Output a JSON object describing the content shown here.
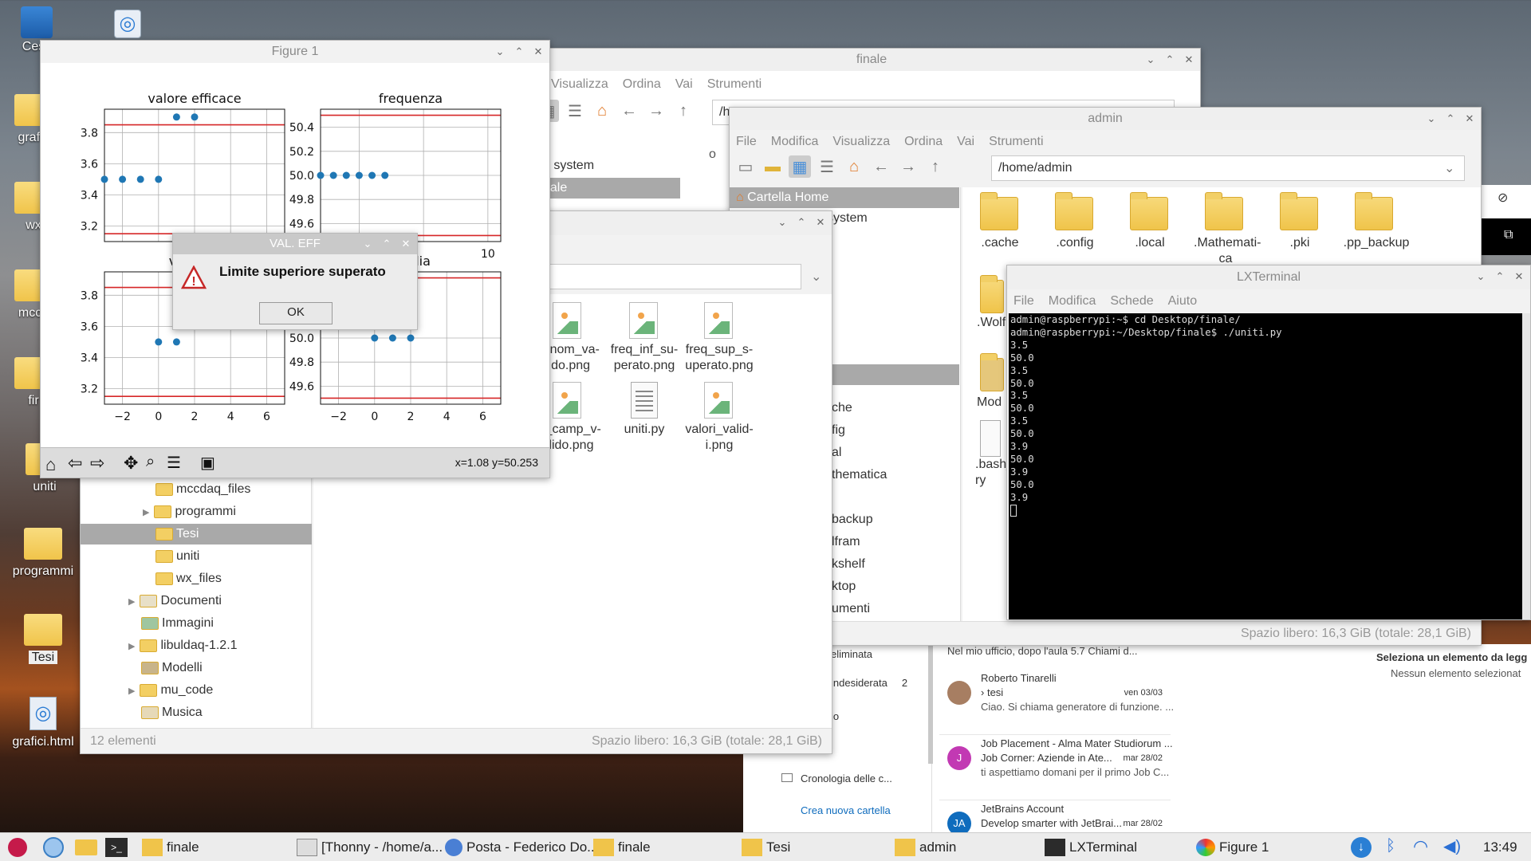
{
  "desktop_icons": [
    {
      "label": "Ces",
      "name": "desktop-icon-trash"
    },
    {
      "label": "grafic",
      "name": "desktop-icon-grafici-folder"
    },
    {
      "label": "wx",
      "name": "desktop-icon-wx"
    },
    {
      "label": "mccd",
      "name": "desktop-icon-mccdaq"
    },
    {
      "label": "fir",
      "name": "desktop-icon-finale"
    },
    {
      "label": "uniti",
      "name": "desktop-icon-uniti"
    },
    {
      "label": "programmi",
      "name": "desktop-icon-programmi"
    },
    {
      "label": "Tesi",
      "name": "desktop-icon-tesi"
    },
    {
      "label": "grafici.html",
      "name": "desktop-icon-grafici-html"
    }
  ],
  "finale_back": {
    "title": "finale",
    "menu": [
      "Visualizza",
      "Ordina",
      "Vai",
      "Strumenti"
    ],
    "path": "/h",
    "side_items": [
      "e",
      "e system",
      "nale",
      "o"
    ]
  },
  "admin_win": {
    "title": "admin",
    "menu": [
      "File",
      "Modifica",
      "Visualizza",
      "Ordina",
      "Vai",
      "Strumenti"
    ],
    "path": "/home/admin",
    "side": [
      "Cartella Home",
      "system"
    ],
    "side_lower": [
      "che",
      "fig",
      "al",
      "thematica",
      "backup",
      "lfram",
      "kshelf",
      "ktop",
      "umenti"
    ],
    "files": [
      ".cache",
      ".config",
      ".local",
      ".Mathemati-ca",
      ".pki",
      ".pp_backup"
    ],
    "files_row2": [
      ".Wolf",
      "Mod",
      ".bash_ ry"
    ],
    "status_right": "Spazio libero: 16,3 GiB (totale: 28,1 GiB)"
  },
  "tesi_win": {
    "files": [
      {
        "label": "ff_nom_va-lido.png",
        "type": "image"
      },
      {
        "label": "freq_inf_su-perato.png",
        "type": "image"
      },
      {
        "label": "freq_sup_s-uperato.png",
        "type": "image"
      },
      {
        "label": "nt_camp_v-alido.png",
        "type": "image"
      },
      {
        "label": "uniti.py",
        "type": "text"
      },
      {
        "label": "valori_valid-i.png",
        "type": "image"
      }
    ],
    "tree": [
      {
        "label": "mccdaq_files",
        "arrow": false,
        "indent": 2
      },
      {
        "label": "programmi",
        "arrow": true,
        "indent": 2
      },
      {
        "label": "Tesi",
        "arrow": false,
        "indent": 2,
        "selected": true
      },
      {
        "label": "uniti",
        "arrow": false,
        "indent": 2
      },
      {
        "label": "wx_files",
        "arrow": false,
        "indent": 2
      },
      {
        "label": "Documenti",
        "arrow": true,
        "indent": 1
      },
      {
        "label": "Immagini",
        "arrow": false,
        "indent": 1
      },
      {
        "label": "libuldaq-1.2.1",
        "arrow": true,
        "indent": 1
      },
      {
        "label": "Modelli",
        "arrow": false,
        "indent": 1
      },
      {
        "label": "mu_code",
        "arrow": true,
        "indent": 1
      },
      {
        "label": "Musica",
        "arrow": false,
        "indent": 1
      }
    ],
    "status_left": "12 elementi",
    "status_right": "Spazio libero: 16,3 GiB (totale: 28,1 GiB)"
  },
  "figure": {
    "title": "Figure 1",
    "coords": "x=1.08 y=50.253"
  },
  "chart_data": [
    {
      "type": "scatter",
      "title": "valore efficace",
      "x": [
        -3,
        -2,
        -1,
        0,
        1,
        2
      ],
      "y": [
        3.5,
        3.5,
        3.5,
        3.5,
        3.9,
        3.9
      ],
      "hlines": [
        3.85,
        3.15
      ],
      "xticks": [
        "2",
        "4"
      ],
      "yticks": [
        "3.8",
        "3.6",
        "3.4",
        "3.2"
      ],
      "ylim": [
        3.1,
        3.95
      ],
      "xlim": [
        -3,
        7
      ]
    },
    {
      "type": "scatter",
      "title": "frequenza",
      "x": [
        -3,
        -2,
        -1,
        0,
        1,
        2
      ],
      "y": [
        50.0,
        50.0,
        50.0,
        50.0,
        50.0,
        50.0
      ],
      "hlines": [
        50.5,
        49.5
      ],
      "xticks": [
        "10"
      ],
      "yticks": [
        "50.4",
        "50.2",
        "50.0",
        "49.8",
        "49.6"
      ],
      "ylim": [
        49.45,
        50.55
      ],
      "xlim": [
        -3,
        11
      ]
    },
    {
      "type": "scatter",
      "title": "valore e",
      "x": [
        0,
        1
      ],
      "y": [
        3.5,
        3.5
      ],
      "hlines": [
        3.85,
        3.15
      ],
      "xticks": [
        "−2",
        "0",
        "2",
        "4",
        "6"
      ],
      "yticks": [
        "3.8",
        "3.6",
        "3.4",
        "3.2"
      ],
      "ylim": [
        3.1,
        3.95
      ],
      "xlim": [
        -3,
        7
      ]
    },
    {
      "type": "scatter",
      "title": "media",
      "x": [
        0,
        1,
        2
      ],
      "y": [
        50.0,
        50.0,
        50.0
      ],
      "hlines": [
        50.5,
        49.5
      ],
      "xticks": [
        "−2",
        "0",
        "2",
        "4",
        "6"
      ],
      "yticks": [
        "50.0",
        "49.8",
        "49.6"
      ],
      "ylim": [
        49.45,
        50.55
      ],
      "xlim": [
        -3,
        7
      ]
    }
  ],
  "dialog": {
    "title": "VAL. EFF",
    "message": "Limite superiore superato",
    "ok": "OK"
  },
  "lxterminal": {
    "title": "LXTerminal",
    "menu": [
      "File",
      "Modifica",
      "Schede",
      "Aiuto"
    ],
    "lines": [
      "admin@raspberrypi:~$ cd Desktop/finale/",
      "admin@raspberrypi:~/Desktop/finale$ ./uniti.py",
      "3.5",
      "50.0",
      "3.5",
      "50.0",
      "3.5",
      "50.0",
      "3.5",
      "50.0",
      "3.9",
      "50.0",
      "3.9",
      "50.0",
      "3.9"
    ]
  },
  "mail": {
    "folders": [
      "eliminata",
      "indesiderata",
      "io",
      "Cronologia delle c...",
      "Crea nuova cartella"
    ],
    "junk_count": "2",
    "preview_top": "Nel mio ufficio, dopo l'aula 5.7 Chiami d...",
    "messages": [
      {
        "sender": "Roberto Tinarelli",
        "subject": "tesi",
        "date": "ven 03/03",
        "preview": "Ciao. Si chiama generatore di funzione. ...",
        "avatar": ""
      },
      {
        "sender": "Job Placement - Alma Mater Studiorum ...",
        "subject": "Job Corner: Aziende in Ate...",
        "date": "mar 28/02",
        "preview": "ti aspettiamo domani per il primo Job C...",
        "avatar": "J"
      },
      {
        "sender": "JetBrains Account",
        "subject": "Develop smarter with JetBrai...",
        "date": "mar 28/02",
        "preview": "",
        "avatar": "JA"
      }
    ],
    "reading_title": "Seleziona un elemento da legg",
    "reading_sub": "Nessun elemento selezionat"
  },
  "taskbar": {
    "items": [
      "finale",
      "[Thonny  -  /home/a...",
      "Posta - Federico Do...",
      "finale",
      "Tesi",
      "admin",
      "LXTerminal",
      "Figure 1"
    ],
    "clock": "13:49"
  },
  "colors": {
    "accent": "#1f77b4",
    "limit": "#d62728",
    "selection": "#a9a9a9"
  }
}
